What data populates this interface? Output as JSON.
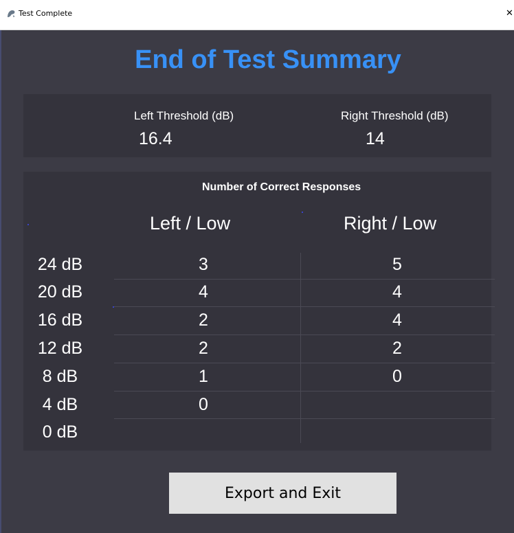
{
  "window": {
    "title": "Test Complete",
    "close_glyph": "✕",
    "icon": "app-logo-icon"
  },
  "heading": "End of Test Summary",
  "thresholds": {
    "left_label": "Left Threshold (dB)",
    "left_value": "16.4",
    "right_label": "Right Threshold (dB)",
    "right_value": "14"
  },
  "responses": {
    "title": "Number of Correct Responses",
    "columns": [
      "Left / Low",
      "Right / Low"
    ],
    "rows": [
      {
        "db": "24 dB",
        "left": "3",
        "right": "5"
      },
      {
        "db": "20 dB",
        "left": "4",
        "right": "4"
      },
      {
        "db": "16 dB",
        "left": "2",
        "right": "4"
      },
      {
        "db": "12 dB",
        "left": "2",
        "right": "2"
      },
      {
        "db": "8 dB",
        "left": "1",
        "right": "0"
      },
      {
        "db": "4 dB",
        "left": "0",
        "right": ""
      },
      {
        "db": "0 dB",
        "left": "",
        "right": ""
      }
    ]
  },
  "export_button": "Export and Exit",
  "colors": {
    "heading": "#3891f6",
    "background": "#3c3b45",
    "panel": "#34333c",
    "button": "#e1e1e1"
  }
}
